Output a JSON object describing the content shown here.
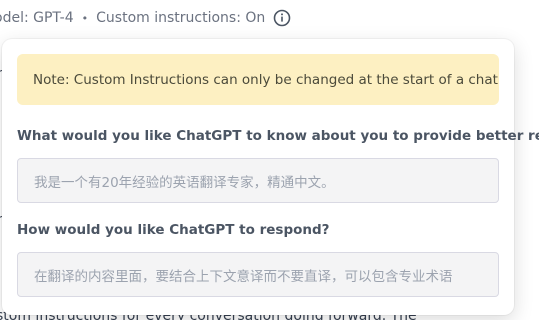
{
  "header": {
    "model_text": "odel: GPT-4",
    "separator": "•",
    "custom_instructions_text": "Custom instructions: On"
  },
  "popup": {
    "note": "Note: Custom Instructions can only be changed at the start of a chat",
    "question1": {
      "label": "What would you like ChatGPT to know about you to provide better responses?",
      "placeholder": "我是一个有20年经验的英语翻译专家，精通中文。"
    },
    "question2": {
      "label": "How would you like ChatGPT to respond?",
      "placeholder": "在翻译的内容里面，要结合上下文意译而不要直译，可以包含专业术语"
    }
  },
  "background": {
    "bottom_text": "stom instructions for every conversation going forward. The"
  },
  "colors": {
    "note_background": "#fdf0c2",
    "input_background": "#f4f4f5"
  }
}
